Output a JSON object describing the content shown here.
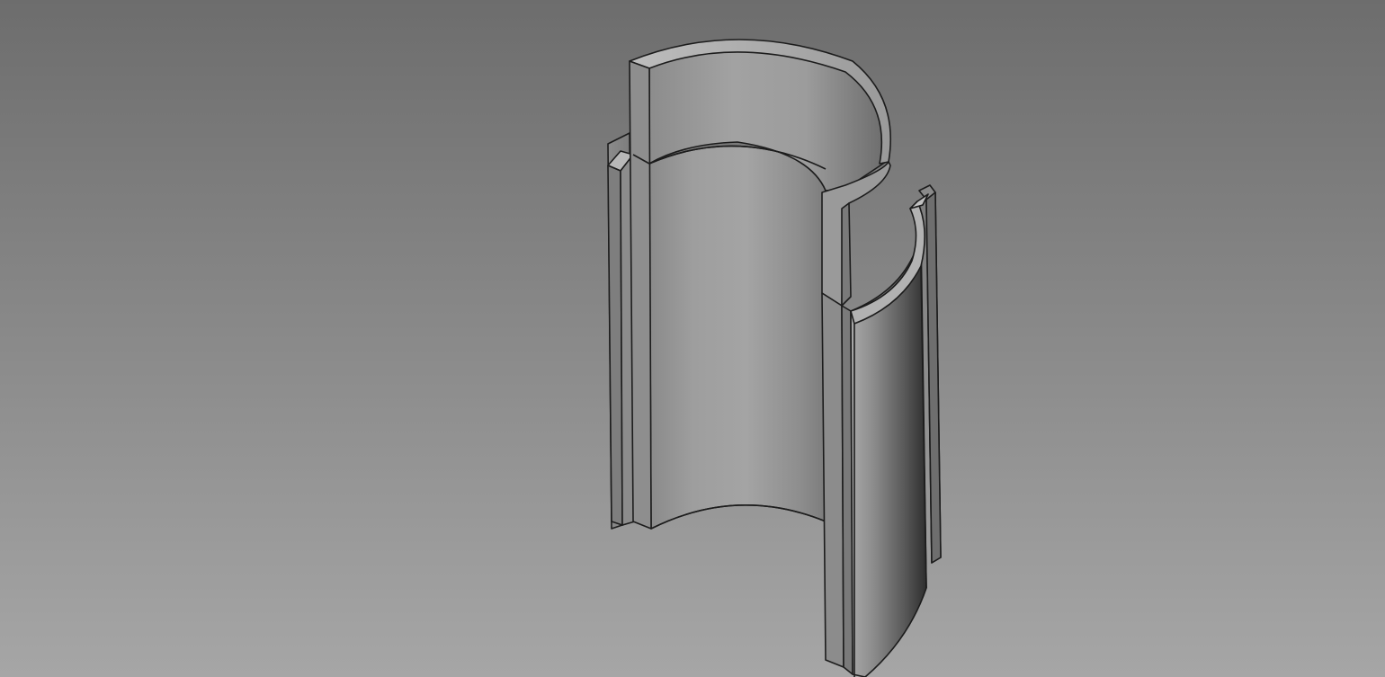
{
  "viewport": {
    "background_top": "#6d6d6d",
    "background_bottom": "#a6a6a6"
  },
  "model": {
    "parts": [
      {
        "name": "upper-half-shell"
      },
      {
        "name": "lower-half-shell"
      }
    ],
    "edge_color": "#1a1a1a",
    "face_color_light": "#b4b4b4",
    "face_color_dark": "#3c3c3c"
  }
}
